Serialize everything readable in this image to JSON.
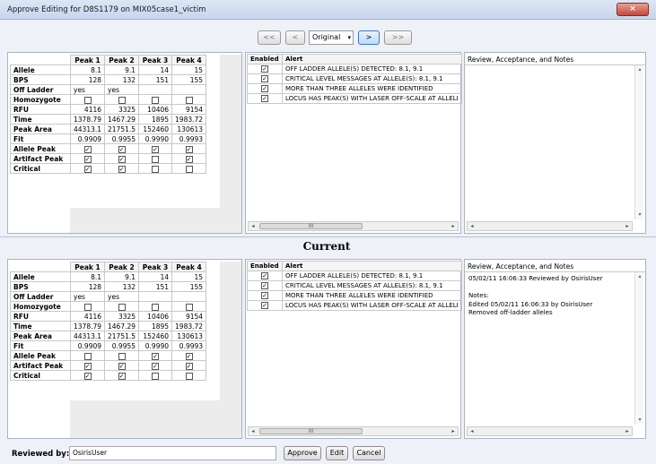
{
  "window": {
    "title": "Approve Editing for D8S1179 on MIX05case1_victim",
    "close_glyph": "×"
  },
  "nav": {
    "first": "<<",
    "prev": "<",
    "view": "Original",
    "next": ">",
    "last": ">>"
  },
  "grid_headers": [
    "Peak 1",
    "Peak 2",
    "Peak 3",
    "Peak 4"
  ],
  "row_labels": {
    "allele": "Allele",
    "bps": "BPS",
    "off_ladder": "Off Ladder",
    "homozygote": "Homozygote",
    "rfu": "RFU",
    "time": "Time",
    "peak_area": "Peak Area",
    "fit": "Fit",
    "allele_peak": "Allele Peak",
    "artifact_peak": "Artifact Peak",
    "critical": "Critical"
  },
  "original": {
    "allele": [
      "8.1",
      "9.1",
      "14",
      "15"
    ],
    "bps": [
      "128",
      "132",
      "151",
      "155"
    ],
    "off_ladder": [
      "yes",
      "yes",
      "",
      ""
    ],
    "homozygote": [
      false,
      false,
      false,
      false
    ],
    "rfu": [
      "4116",
      "3325",
      "10406",
      "9154"
    ],
    "time": [
      "1378.79",
      "1467.29",
      "1895",
      "1983.72"
    ],
    "peak_area": [
      "44313.1",
      "21751.5",
      "152460",
      "130613"
    ],
    "fit": [
      "0.9909",
      "0.9955",
      "0.9990",
      "0.9993"
    ],
    "allele_peak": [
      true,
      true,
      true,
      true
    ],
    "artifact_peak": [
      true,
      true,
      false,
      true
    ],
    "critical": [
      true,
      true,
      false,
      false
    ]
  },
  "current": {
    "allele": [
      "8.1",
      "9.1",
      "14",
      "15"
    ],
    "bps": [
      "128",
      "132",
      "151",
      "155"
    ],
    "off_ladder": [
      "yes",
      "yes",
      "",
      ""
    ],
    "homozygote": [
      false,
      false,
      false,
      false
    ],
    "rfu": [
      "4116",
      "3325",
      "10406",
      "9154"
    ],
    "time": [
      "1378.79",
      "1467.29",
      "1895",
      "1983.72"
    ],
    "peak_area": [
      "44313.1",
      "21751.5",
      "152460",
      "130613"
    ],
    "fit": [
      "0.9909",
      "0.9955",
      "0.9990",
      "0.9993"
    ],
    "allele_peak": [
      false,
      false,
      true,
      true
    ],
    "artifact_peak": [
      true,
      true,
      true,
      true
    ],
    "critical": [
      true,
      true,
      false,
      false
    ]
  },
  "alerts_header": {
    "enabled": "Enabled",
    "alert": "Alert"
  },
  "alerts_original": [
    {
      "enabled": true,
      "text": "OFF LADDER ALLELE(S) DETECTED: 8.1, 9.1"
    },
    {
      "enabled": true,
      "text": "CRITICAL LEVEL MESSAGES AT ALLELE(S): 8.1, 9.1"
    },
    {
      "enabled": true,
      "text": "MORE THAN THREE ALLELES WERE IDENTIFIED"
    },
    {
      "enabled": true,
      "text": "LOCUS HAS PEAK(S) WITH LASER OFF-SCALE AT ALLELI"
    }
  ],
  "alerts_current": [
    {
      "enabled": true,
      "text": "OFF LADDER ALLELE(S) DETECTED: 8.1, 9.1"
    },
    {
      "enabled": true,
      "text": "CRITICAL LEVEL MESSAGES AT ALLELE(S): 8.1, 9.1"
    },
    {
      "enabled": true,
      "text": "MORE THAN THREE ALLELES WERE IDENTIFIED"
    },
    {
      "enabled": true,
      "text": "LOCUS HAS PEAK(S) WITH LASER OFF-SCALE AT ALLELI"
    }
  ],
  "notes": {
    "header": "Review, Acceptance, and Notes",
    "original_text": "",
    "current_text": "05/02/11 16:06:33 Reviewed by OsirisUser\n\nNotes:\nEdited 05/02/11 16:06:33 by OsirisUser\nRemoved off-ladder alleles"
  },
  "current_label": "Current",
  "footer": {
    "reviewed_by_label": "Reviewed by:",
    "reviewed_by_value": "OsirisUser",
    "approve": "Approve",
    "edit": "Edit",
    "cancel": "Cancel"
  },
  "scroll": {
    "left": "◂",
    "right": "▸",
    "up": "▴",
    "down": "▾",
    "grip": "III"
  }
}
